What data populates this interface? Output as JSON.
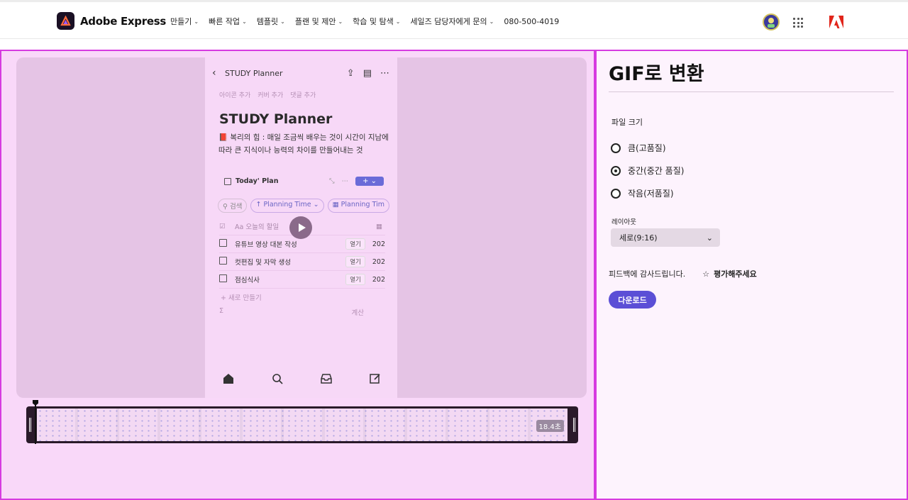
{
  "brand": {
    "name": "Adobe Express"
  },
  "nav": {
    "items": [
      "만들기",
      "빠른 작업",
      "템플릿",
      "플랜 및 제안",
      "학습 및 탐색",
      "세일즈 담당자에게 문의"
    ],
    "phone": "080-500-4019"
  },
  "preview": {
    "header_title": "STUDY Planner",
    "meta": [
      "아이콘 추가",
      "커버 추가",
      "댓글 추가"
    ],
    "heading": "STUDY Planner",
    "description": "📕 복리의 힘 : 매일 조금씩 배우는 것이 시간이 지남에 따라 큰 지식이나 능력의 차이를 만들어내는 것",
    "view_name": "Today' Plan",
    "filters": [
      "검색",
      "↑ Planning Time",
      "Planning Tim"
    ],
    "table_header": {
      "title": "Aa 오늘의 할일"
    },
    "rows": [
      {
        "title": "유튜브 영상 대본 작성",
        "open": "열기",
        "date": "202"
      },
      {
        "title": "컷편집 및 자막 생성",
        "open": "열기",
        "date": "202"
      },
      {
        "title": "점심식사",
        "open": "열기",
        "date": "202"
      }
    ],
    "new_row": "+ 새로 만들기",
    "sum_left": "Σ",
    "sum_right": "계산"
  },
  "timeline": {
    "duration": "18.4초"
  },
  "panel": {
    "title": "GIF로 변환",
    "file_size_label": "파일 크기",
    "options": [
      {
        "label": "큼(고품질)",
        "selected": false
      },
      {
        "label": "중간(중간 품질)",
        "selected": true
      },
      {
        "label": "작음(저품질)",
        "selected": false
      }
    ],
    "layout_label": "레이아웃",
    "layout_value": "세로(9:16)",
    "feedback": "피드백에 감사드립니다.",
    "rate": "평가해주세요",
    "download": "다운로드"
  },
  "colors": {
    "accent": "#5b4fd6",
    "highlight_border": "#d63be0",
    "adobe_red": "#e1251b"
  }
}
